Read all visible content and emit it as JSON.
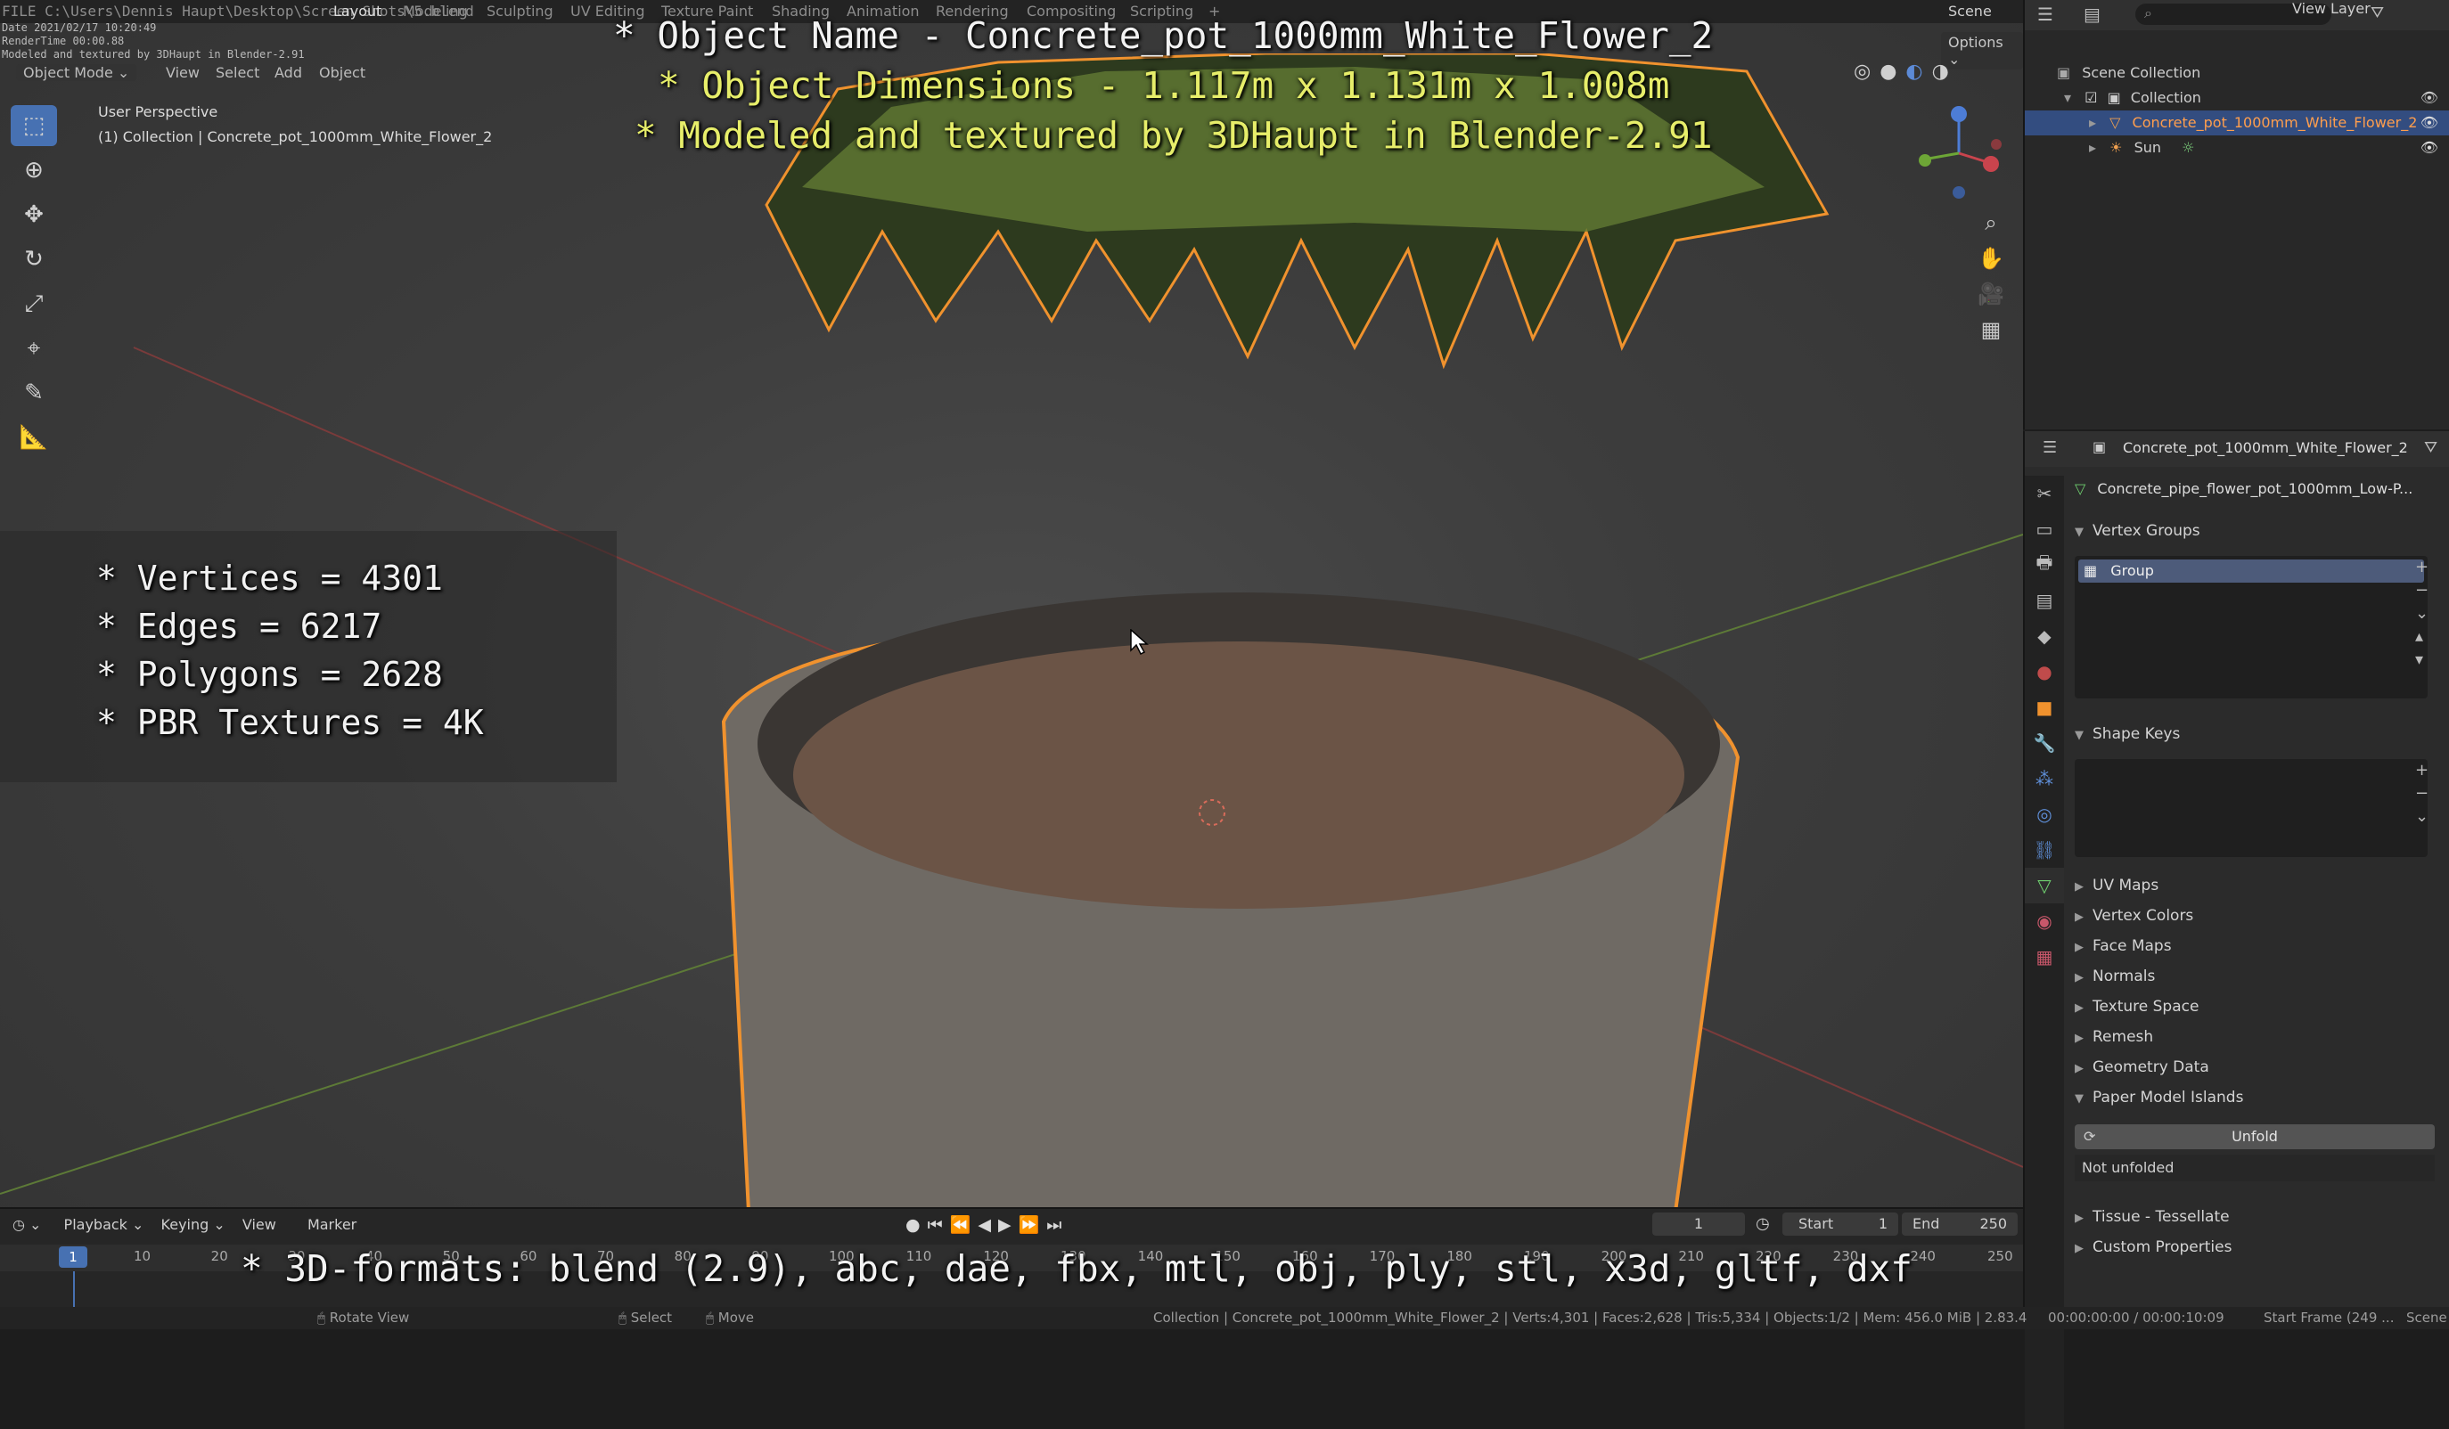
{
  "window": {
    "file_path": "FILE C:\\Users\\Dennis Haupt\\Desktop\\Screen Shots\\5.blend",
    "date_line": "Date 2021/02/17 10:20:49",
    "render_time_line": "RenderTime 00:00.88",
    "modeled_line": "Modeled and textured by 3DHaupt in Blender-2.91",
    "scene_label": "Scene",
    "view_layer_label": "View Layer"
  },
  "workspace_tabs": [
    "Layout",
    "Modeling",
    "Sculpting",
    "UV Editing",
    "Texture Paint",
    "Shading",
    "Animation",
    "Rendering",
    "Compositing",
    "Scripting",
    "+"
  ],
  "viewport": {
    "mode": "Object Mode",
    "menu": [
      "View",
      "Select",
      "Add",
      "Object"
    ],
    "options": "Options",
    "perspective": "User Perspective",
    "collection_info": "(1) Collection | Concrete_pot_1000mm_White_Flower_2"
  },
  "overlay": {
    "title_lines": [
      "* Object Name - Concrete_pot_1000mm_White_Flower_2",
      "* Object Dimensions -  1.117m x 1.131m x 1.008m",
      "* Modeled and textured by 3DHaupt in Blender-2.91"
    ],
    "stats": [
      "* Vertices = 4301",
      "* Edges = 6217",
      "* Polygons = 2628",
      "* PBR Textures = 4K"
    ],
    "formats": "* 3D-formats: blend (2.9), abc, dae, fbx, mtl, obj, ply, stl, x3d, gltf, dxf"
  },
  "outliner": {
    "root": "Scene Collection",
    "collection": "Collection",
    "items": [
      "Concrete_pot_1000mm_White_Flower_2",
      "Sun"
    ]
  },
  "properties": {
    "object_name": "Concrete_pot_1000mm_White_Flower_2",
    "mesh_name": "Concrete_pipe_flower_pot_1000mm_Low-P...",
    "vertex_groups_title": "Vertex Groups",
    "group_item": "Group",
    "shape_keys_title": "Shape Keys",
    "collapsed_sections": [
      "UV Maps",
      "Vertex Colors",
      "Face Maps",
      "Normals",
      "Texture Space",
      "Remesh",
      "Geometry Data"
    ],
    "paper_model_title": "Paper Model Islands",
    "unfold_button": "Unfold",
    "unfold_status": "Not unfolded",
    "tail_sections": [
      "Tissue - Tessellate",
      "Custom Properties"
    ]
  },
  "timeline": {
    "menus": [
      "Playback",
      "Keying",
      "View",
      "Marker"
    ],
    "current_frame": "1",
    "start_label": "Start",
    "start_value": "1",
    "end_label": "End",
    "end_value": "250",
    "ruler_ticks": [
      "1",
      "10",
      "20",
      "30",
      "40",
      "50",
      "60",
      "70",
      "80",
      "90",
      "100",
      "110",
      "120",
      "130",
      "140",
      "150",
      "160",
      "170",
      "180",
      "190",
      "200",
      "210",
      "220",
      "230",
      "240",
      "250"
    ]
  },
  "statusbar": {
    "rotate_view": "Rotate View",
    "select": "Select",
    "move": "Move",
    "info": "Collection | Concrete_pot_1000mm_White_Flower_2 | Verts:4,301 | Faces:2,628 | Tris:5,334 | Objects:1/2 | Mem: 456.0 MiB | 2.83.4",
    "timecode": "00:00:00:00 / 00:00:10:09",
    "start_frame": "Start Frame (249 ...",
    "scene": "Scene"
  },
  "colors": {
    "accent": "#4771b2",
    "selection_outline": "#f0922e",
    "highlight_text": "#e7ee6a"
  }
}
